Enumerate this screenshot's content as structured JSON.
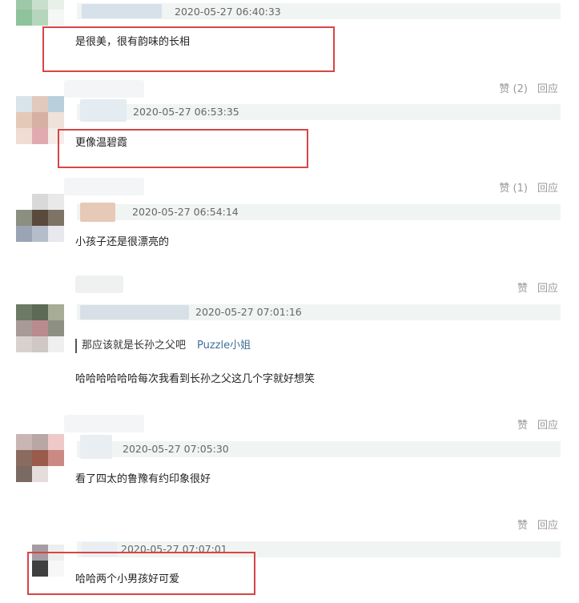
{
  "comments": [
    {
      "time": "2020-05-27 06:40:33",
      "text": "是很美，很有韵味的长相",
      "likes": "赞 (2)",
      "reply": "回应"
    },
    {
      "time": "2020-05-27 06:53:35",
      "text": "更像温碧霞",
      "likes": "赞 (1)",
      "reply": "回应"
    },
    {
      "time": "2020-05-27 06:54:14",
      "text": "小孩子还是很漂亮的",
      "likes": "赞",
      "reply": "回应"
    },
    {
      "time": "2020-05-27 07:01:16",
      "quote": "那应该就是长孙之父吧",
      "quote_author": "Puzzle小姐",
      "text": "哈哈哈哈哈哈每次我看到长孙之父这几个字就好想笑",
      "likes": "赞",
      "reply": "回应"
    },
    {
      "time": "2020-05-27 07:05:30",
      "text": "看了四太的鲁豫有约印象很好",
      "likes": "赞",
      "reply": "回应"
    },
    {
      "time": "2020-05-27 07:07:01",
      "text": "哈哈两个小男孩好可爱"
    }
  ],
  "colors": {
    "highlight_box": "#d64545",
    "meta_bar": "#f0f4f2",
    "author_link": "#3e6f98"
  }
}
